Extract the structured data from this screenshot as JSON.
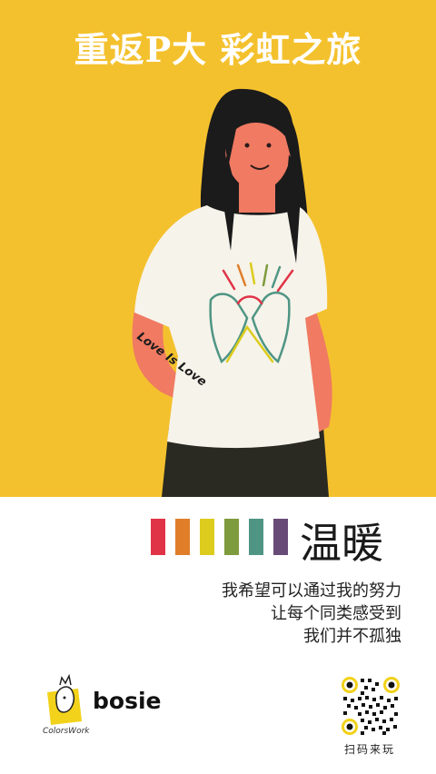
{
  "poster": {
    "title": "重返P大 彩虹之旅",
    "arm_tattoo": "Love Is Love",
    "theme_word": "温暖",
    "quote_lines": [
      "我希望可以通过我的努力",
      "让每个同类感受到",
      "我们并不孤独"
    ],
    "colors": {
      "background": "#F4C12E",
      "skin": "#F07A62",
      "hair": "#1B1B1B",
      "shirt": "#F6F3EA",
      "pants": "#2A2A22"
    },
    "rainbow": [
      "#E03347",
      "#E07E2A",
      "#DCCC1D",
      "#7E9B3D",
      "#4F9584",
      "#694B78"
    ]
  },
  "footer": {
    "colorswork_label": "ColorsWork",
    "bosie_label": "bosie",
    "qr_label": "扫码来玩",
    "qr_accent": "#F2D21A"
  }
}
